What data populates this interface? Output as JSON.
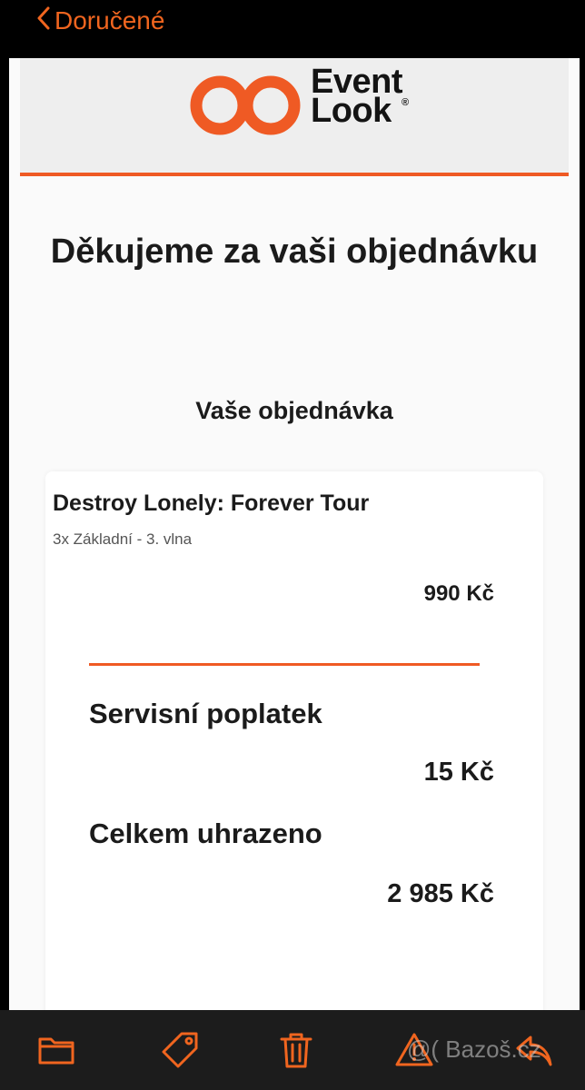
{
  "nav": {
    "back_label": "Doručené"
  },
  "brand": {
    "line1": "Event",
    "line2": "Look",
    "reg": "®",
    "accent": "#ef5a24"
  },
  "email": {
    "title": "Děkujeme za vaši objednávku",
    "order_heading": "Vaše objednávka",
    "item": {
      "name": "Destroy Lonely: Forever Tour",
      "variant": "3x Základní - 3. vlna",
      "price": "990 Kč"
    },
    "fee": {
      "label": "Servisní poplatek",
      "value": "15 Kč"
    },
    "total": {
      "label": "Celkem uhrazeno",
      "value": "2 985 Kč"
    }
  },
  "toolbar": {
    "icons": [
      "folder-icon",
      "tag-icon",
      "trash-icon",
      "warning-icon",
      "reply-icon"
    ]
  },
  "watermark": {
    "text": "@( Bazoš.cz"
  }
}
